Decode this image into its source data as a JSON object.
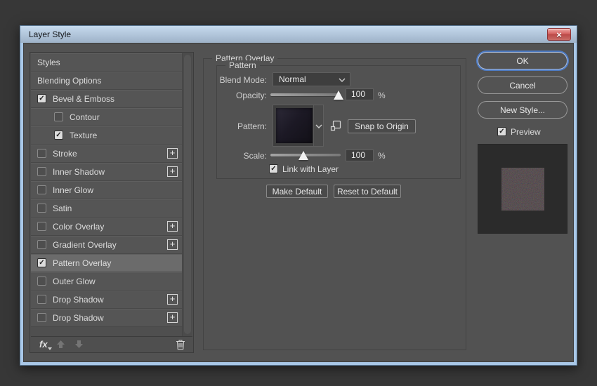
{
  "window": {
    "title": "Layer Style"
  },
  "glyphs": {
    "close": "×",
    "check": "✓",
    "plus": "+",
    "fx": "fx"
  },
  "colors": {
    "accent_blue": "#4d7ac2",
    "titlebar_blue": "#c6daee",
    "close_red": "#c9514d",
    "panel_bg": "#525252",
    "selected_row_bg": "#6b6b6b",
    "preview_bg": "#2b2b2b"
  },
  "sidebar": {
    "items": [
      {
        "label": "Styles",
        "type": "plain"
      },
      {
        "label": "Blending Options",
        "type": "plain"
      },
      {
        "label": "Bevel & Emboss",
        "type": "check",
        "checked": true
      },
      {
        "label": "Contour",
        "type": "check",
        "checked": false,
        "indent": true
      },
      {
        "label": "Texture",
        "type": "check",
        "checked": true,
        "indent": true
      },
      {
        "label": "Stroke",
        "type": "check",
        "checked": false,
        "plus": true
      },
      {
        "label": "Inner Shadow",
        "type": "check",
        "checked": false,
        "plus": true
      },
      {
        "label": "Inner Glow",
        "type": "check",
        "checked": false
      },
      {
        "label": "Satin",
        "type": "check",
        "checked": false
      },
      {
        "label": "Color Overlay",
        "type": "check",
        "checked": false,
        "plus": true
      },
      {
        "label": "Gradient Overlay",
        "type": "check",
        "checked": false,
        "plus": true
      },
      {
        "label": "Pattern Overlay",
        "type": "check",
        "checked": true,
        "selected": true
      },
      {
        "label": "Outer Glow",
        "type": "check",
        "checked": false
      },
      {
        "label": "Drop Shadow",
        "type": "check",
        "checked": false,
        "plus": true
      },
      {
        "label": "Drop Shadow",
        "type": "check",
        "checked": false,
        "plus": true
      }
    ]
  },
  "panel": {
    "group_title": "Pattern Overlay",
    "subgroup_title": "Pattern",
    "blend_mode": {
      "label": "Blend Mode:",
      "value": "Normal"
    },
    "opacity": {
      "label": "Opacity:",
      "value": "100",
      "unit": "%",
      "percent": 97
    },
    "pattern": {
      "label": "Pattern:",
      "snap_button_label": "Snap to Origin"
    },
    "scale": {
      "label": "Scale:",
      "value": "100",
      "unit": "%",
      "percent": 47
    },
    "link_with_layer": {
      "label": "Link with Layer",
      "checked": true
    },
    "make_default_label": "Make Default",
    "reset_label": "Reset to Default"
  },
  "actions": {
    "ok_label": "OK",
    "cancel_label": "Cancel",
    "new_style_label": "New Style...",
    "preview_label": "Preview",
    "preview_checked": true
  }
}
